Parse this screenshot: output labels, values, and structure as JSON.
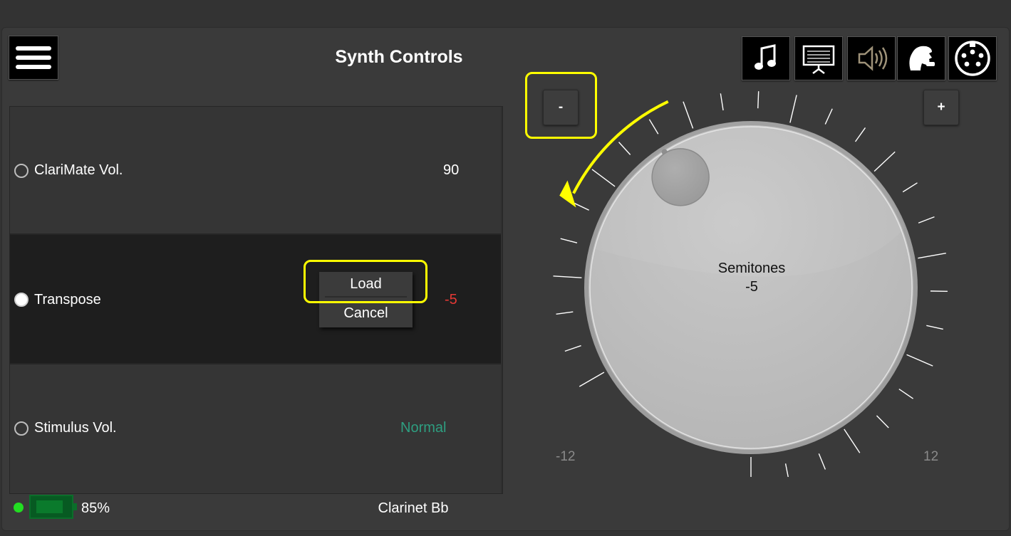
{
  "header": {
    "title": "Synth Controls"
  },
  "toolbar": {
    "icons": [
      "music-note-icon",
      "music-stand-icon",
      "speaker-icon",
      "player-icon",
      "midi-icon"
    ]
  },
  "list": {
    "rows": [
      {
        "label": "ClariMate Vol.",
        "value": "90",
        "value_color": "#ffffff",
        "selected": false
      },
      {
        "label": "Transpose",
        "value": "-5",
        "value_color": "#e53935",
        "selected": true
      },
      {
        "label": "Stimulus Vol.",
        "value": "Normal",
        "value_color": "#2e9e80",
        "selected": false
      }
    ]
  },
  "context_menu": {
    "load": "Load",
    "cancel": "Cancel"
  },
  "knob": {
    "minus_label": "-",
    "plus_label": "+",
    "label": "Semitones",
    "value": -5,
    "value_text": "-5",
    "min": -12,
    "max": 12,
    "min_label": "-12",
    "max_label": "12"
  },
  "status": {
    "battery_percent": 85,
    "battery_text": "85%",
    "instrument": "Clarinet Bb"
  },
  "colors": {
    "highlight": "#ffff00",
    "battery": "#0a7a2c",
    "status_dot": "#22dd22"
  }
}
